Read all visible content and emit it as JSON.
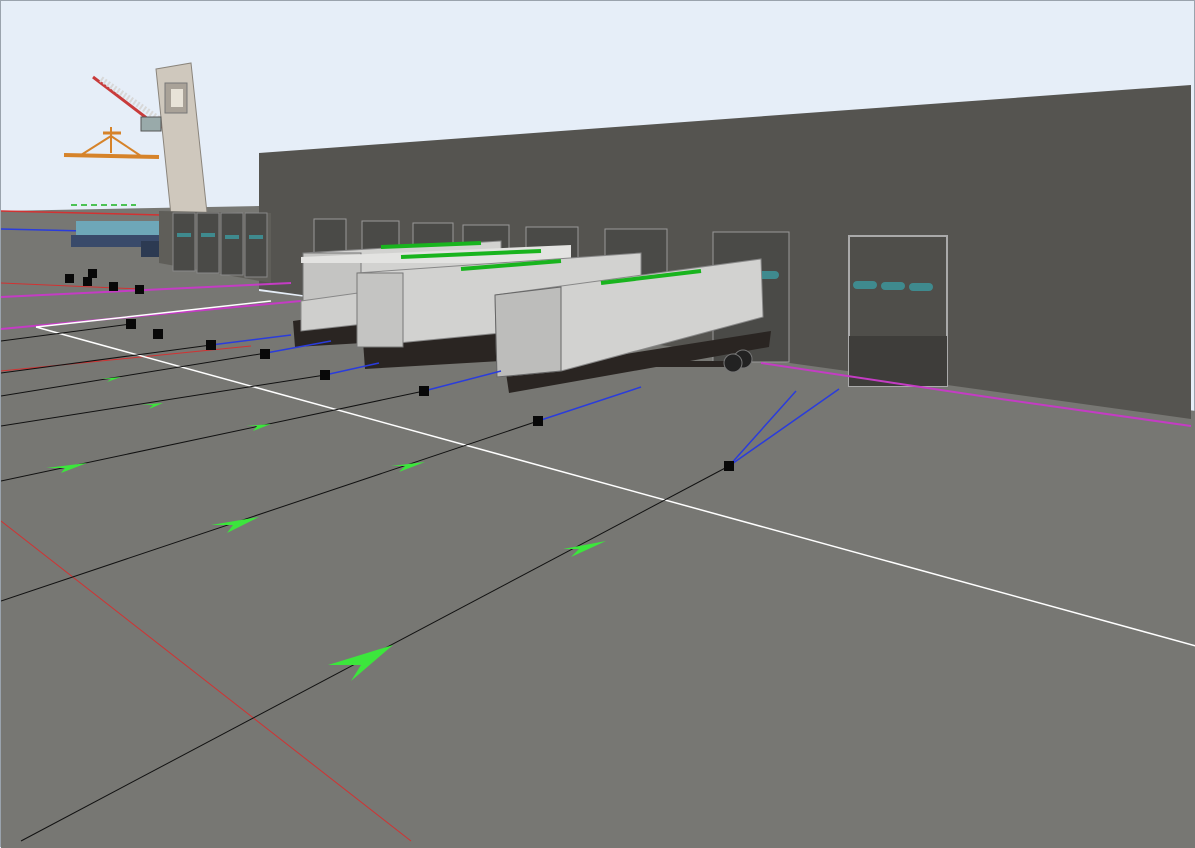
{
  "view": {
    "type": "3d-simulation-viewport",
    "background": "#e6eef8",
    "floor_color": "#777773",
    "warehouse_wall_color": "#555450",
    "dock_door_color": "#4a4a47",
    "dock_window_color": "#3f8a8e",
    "container_color": "#d2d2d0",
    "container_label_color": "#19b41e",
    "trailer_color": "#2a2522",
    "crane_boom_color": "#c83b3b",
    "spreader_color": "#d6832a",
    "path_line_color": "#111111",
    "control_line_color": "#2a3cdc",
    "zone_line_color": "#c43cc4",
    "grid_line_color": "#d23232",
    "arrow_color": "#3ce63c",
    "node_color": "#080808"
  },
  "objects": {
    "containers": 4,
    "trailers": 4,
    "dock_doors": 8
  }
}
